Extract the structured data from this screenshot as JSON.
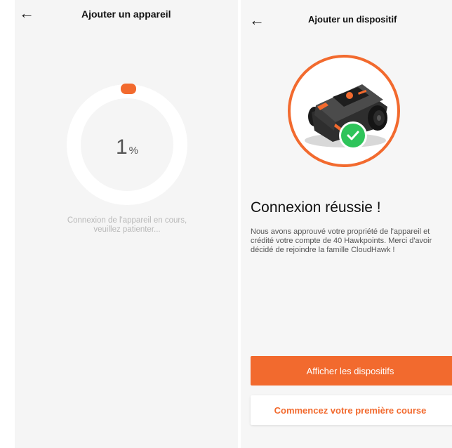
{
  "left_screen": {
    "back_icon": "arrow-left-icon",
    "title": "Ajouter un appareil",
    "progress_number": "1",
    "progress_unit": "%",
    "progress_fraction": 0.01,
    "status_line1": "Connexion de l'appareil en cours,",
    "status_line2": "veuillez patienter...",
    "accent_color": "#f26a2e",
    "ring_color": "#ffffff"
  },
  "right_screen": {
    "back_icon": "arrow-left-icon",
    "title": "Ajouter un dispositif",
    "image_alt": "robot-mower",
    "success_icon": "check-circle-icon",
    "heading": "Connexion réussie !",
    "body": "Nous avons approuvé votre propriété de l'appareil et\ncrédité votre compte de 40 Hawkpoints. Merci d'avoir\ndécidé de rejoindre la famille CloudHawk !",
    "primary_button": "Afficher les dispositifs",
    "secondary_button": "Commencez votre première course",
    "accent_color": "#f26a2e",
    "success_color": "#2ec45a"
  }
}
